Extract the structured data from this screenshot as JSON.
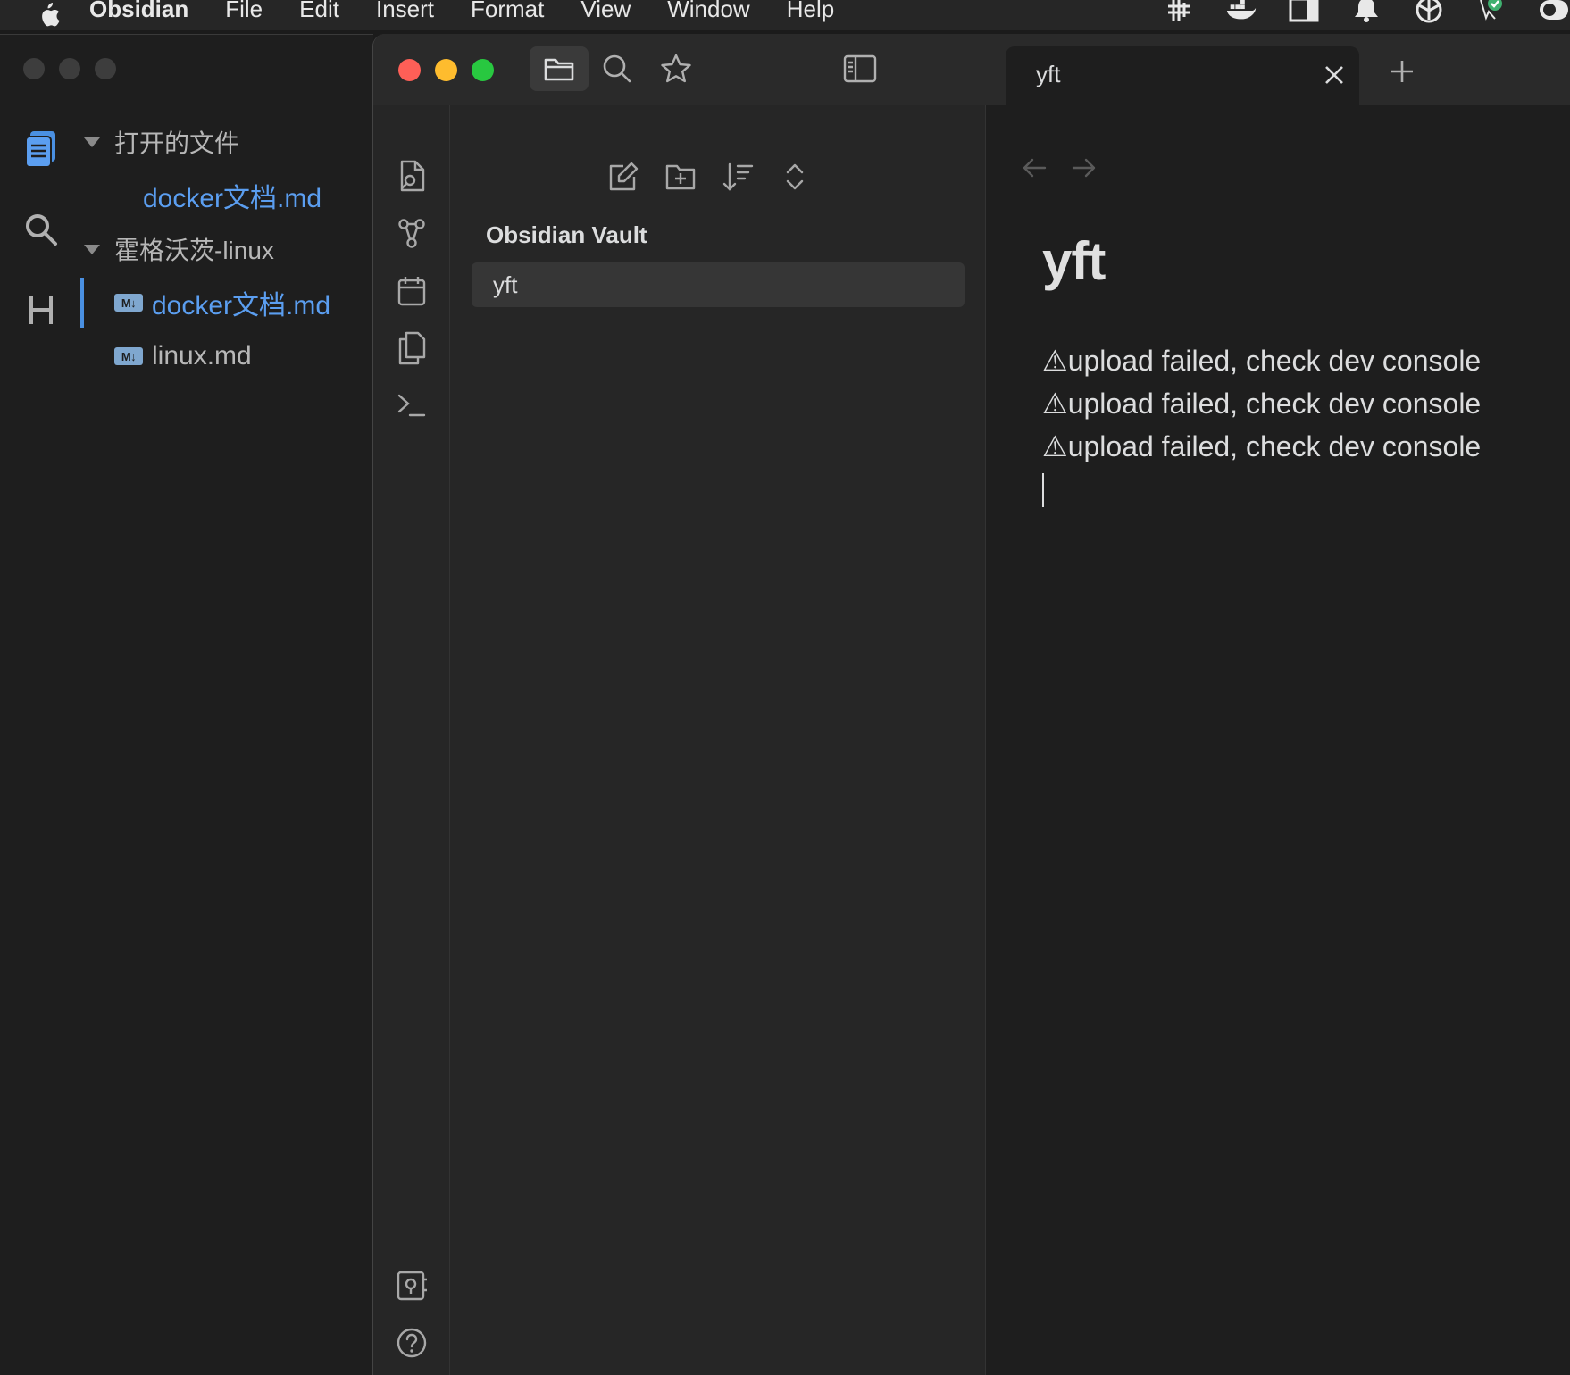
{
  "menubar": {
    "app": "Obsidian",
    "items": [
      "File",
      "Edit",
      "Insert",
      "Format",
      "View",
      "Window",
      "Help"
    ],
    "tray_icons": [
      "hashtag-grid-icon",
      "docker-icon",
      "window-split-icon",
      "bell-icon",
      "box-icon",
      "check-badge-icon",
      "toggle-icon"
    ]
  },
  "left_window": {
    "ribbon_icons": [
      "files-icon",
      "search-icon",
      "heading-icon"
    ],
    "open_files_label": "打开的文件",
    "open_file": "docker文档.md",
    "folder_label": "霍格沃茨-linux",
    "md_badge": "M↓",
    "files": [
      "docker文档.md",
      "linux.md"
    ]
  },
  "main_window": {
    "toolbar_icons": [
      "folder-icon",
      "search-icon",
      "star-icon",
      "sidebar-toggle-icon"
    ],
    "tab_title": "yft",
    "ribbon_top_icons": [
      "open-note-icon",
      "graph-icon",
      "calendar-icon",
      "copy-icon",
      "terminal-icon"
    ],
    "ribbon_bottom_icons": [
      "vault-icon",
      "help-icon"
    ],
    "explorer": {
      "actions": [
        "new-note-icon",
        "new-folder-icon",
        "sort-icon",
        "collapse-icon"
      ],
      "vault_name": "Obsidian Vault",
      "items": [
        "yft"
      ]
    },
    "editor": {
      "title": "yft",
      "lines": [
        "⚠upload failed, check dev console",
        "⚠upload failed, check dev console",
        "⚠upload failed, check dev console"
      ]
    }
  },
  "colors": {
    "accent": "#5b9ef0",
    "traffic_red": "#fe5f57",
    "traffic_yellow": "#febc2e",
    "traffic_green": "#28c840"
  }
}
